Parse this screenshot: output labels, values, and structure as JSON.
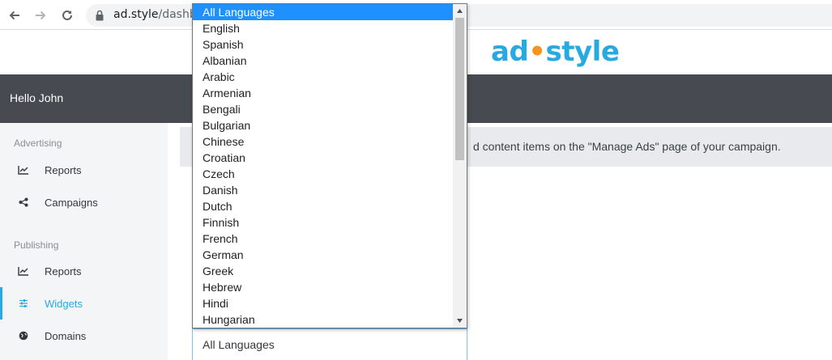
{
  "browser": {
    "url_host": "ad.style",
    "url_path": "/dashbo"
  },
  "brand": {
    "logo_left": "ad",
    "logo_right": "style",
    "primary_color": "#27aae1",
    "accent_color": "#f7931e"
  },
  "header": {
    "greeting": "Hello John"
  },
  "sidebar": {
    "sections": [
      {
        "title": "Advertising",
        "items": [
          {
            "label": "Reports",
            "icon": "line-chart-icon"
          },
          {
            "label": "Campaigns",
            "icon": "share-icon"
          }
        ]
      },
      {
        "title": "Publishing",
        "items": [
          {
            "label": "Reports",
            "icon": "line-chart-icon"
          },
          {
            "label": "Widgets",
            "icon": "sliders-icon",
            "active": true
          },
          {
            "label": "Domains",
            "icon": "globe-icon"
          }
        ]
      }
    ]
  },
  "main": {
    "info_text": "d content items on the \"Manage Ads\" page of your campaign.",
    "language_select": {
      "value": "All Languages",
      "options": [
        "All Languages",
        "English",
        "Spanish",
        "Albanian",
        "Arabic",
        "Armenian",
        "Bengali",
        "Bulgarian",
        "Chinese",
        "Croatian",
        "Czech",
        "Danish",
        "Dutch",
        "Finnish",
        "French",
        "German",
        "Greek",
        "Hebrew",
        "Hindi",
        "Hungarian"
      ],
      "highlighted_index": 0
    }
  }
}
